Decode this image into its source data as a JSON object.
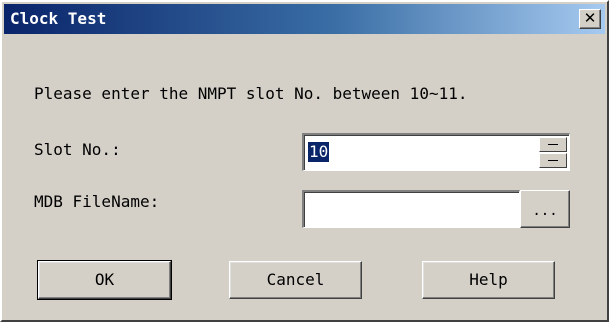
{
  "window": {
    "title": "Clock Test",
    "close_glyph": "✕"
  },
  "dialog": {
    "instruction": "Please enter the NMPT slot No. between 10~11.",
    "slot_label": "Slot No.:",
    "slot_value": "10",
    "mdb_label": "MDB FileName:",
    "mdb_value": "",
    "browse_label": "..."
  },
  "buttons": {
    "ok": "OK",
    "cancel": "Cancel",
    "help": "Help"
  },
  "icons": {
    "close": "close-icon",
    "spin_up": "chevron-up-icon",
    "spin_down": "chevron-down-icon"
  },
  "colors": {
    "titlebar_start": "#0a246a",
    "titlebar_end": "#a6caf0",
    "dialog_face": "#d4d0c8",
    "selection": "#0a246a"
  }
}
